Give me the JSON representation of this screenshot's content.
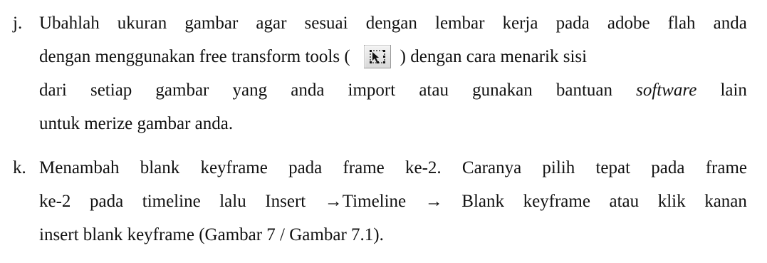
{
  "items": [
    {
      "marker": "j.",
      "line1": [
        "Ubahlah",
        "ukuran",
        "gambar",
        "agar",
        "sesuai",
        "dengan",
        "lembar",
        "kerja",
        "pada",
        "adobe",
        "flah",
        "anda"
      ],
      "line2_before": "dengan menggunakan free transform tools (",
      "line2_after": ") dengan cara menarik sisi",
      "line3": [
        "dari",
        "setiap",
        "gambar",
        "yang",
        "anda",
        "import",
        "atau",
        "gunakan",
        "bantuan"
      ],
      "line3_italic": "software",
      "line3_end": "lain",
      "line4": "untuk merize gambar anda.",
      "icon": "free-transform-tool-icon"
    },
    {
      "marker": "k.",
      "line1": [
        "Menambah",
        "blank",
        "keyframe",
        "pada",
        "frame",
        "ke-2.",
        "Caranya",
        "pilih",
        "tepat",
        "pada",
        "frame"
      ],
      "line2": [
        "ke-2",
        "pada",
        "timeline",
        "lalu",
        "Insert",
        "→Timeline",
        "→",
        "Blank",
        "keyframe",
        "atau",
        "klik",
        "kanan"
      ],
      "line3": "insert blank keyframe (Gambar 7 / Gambar 7.1)."
    }
  ]
}
